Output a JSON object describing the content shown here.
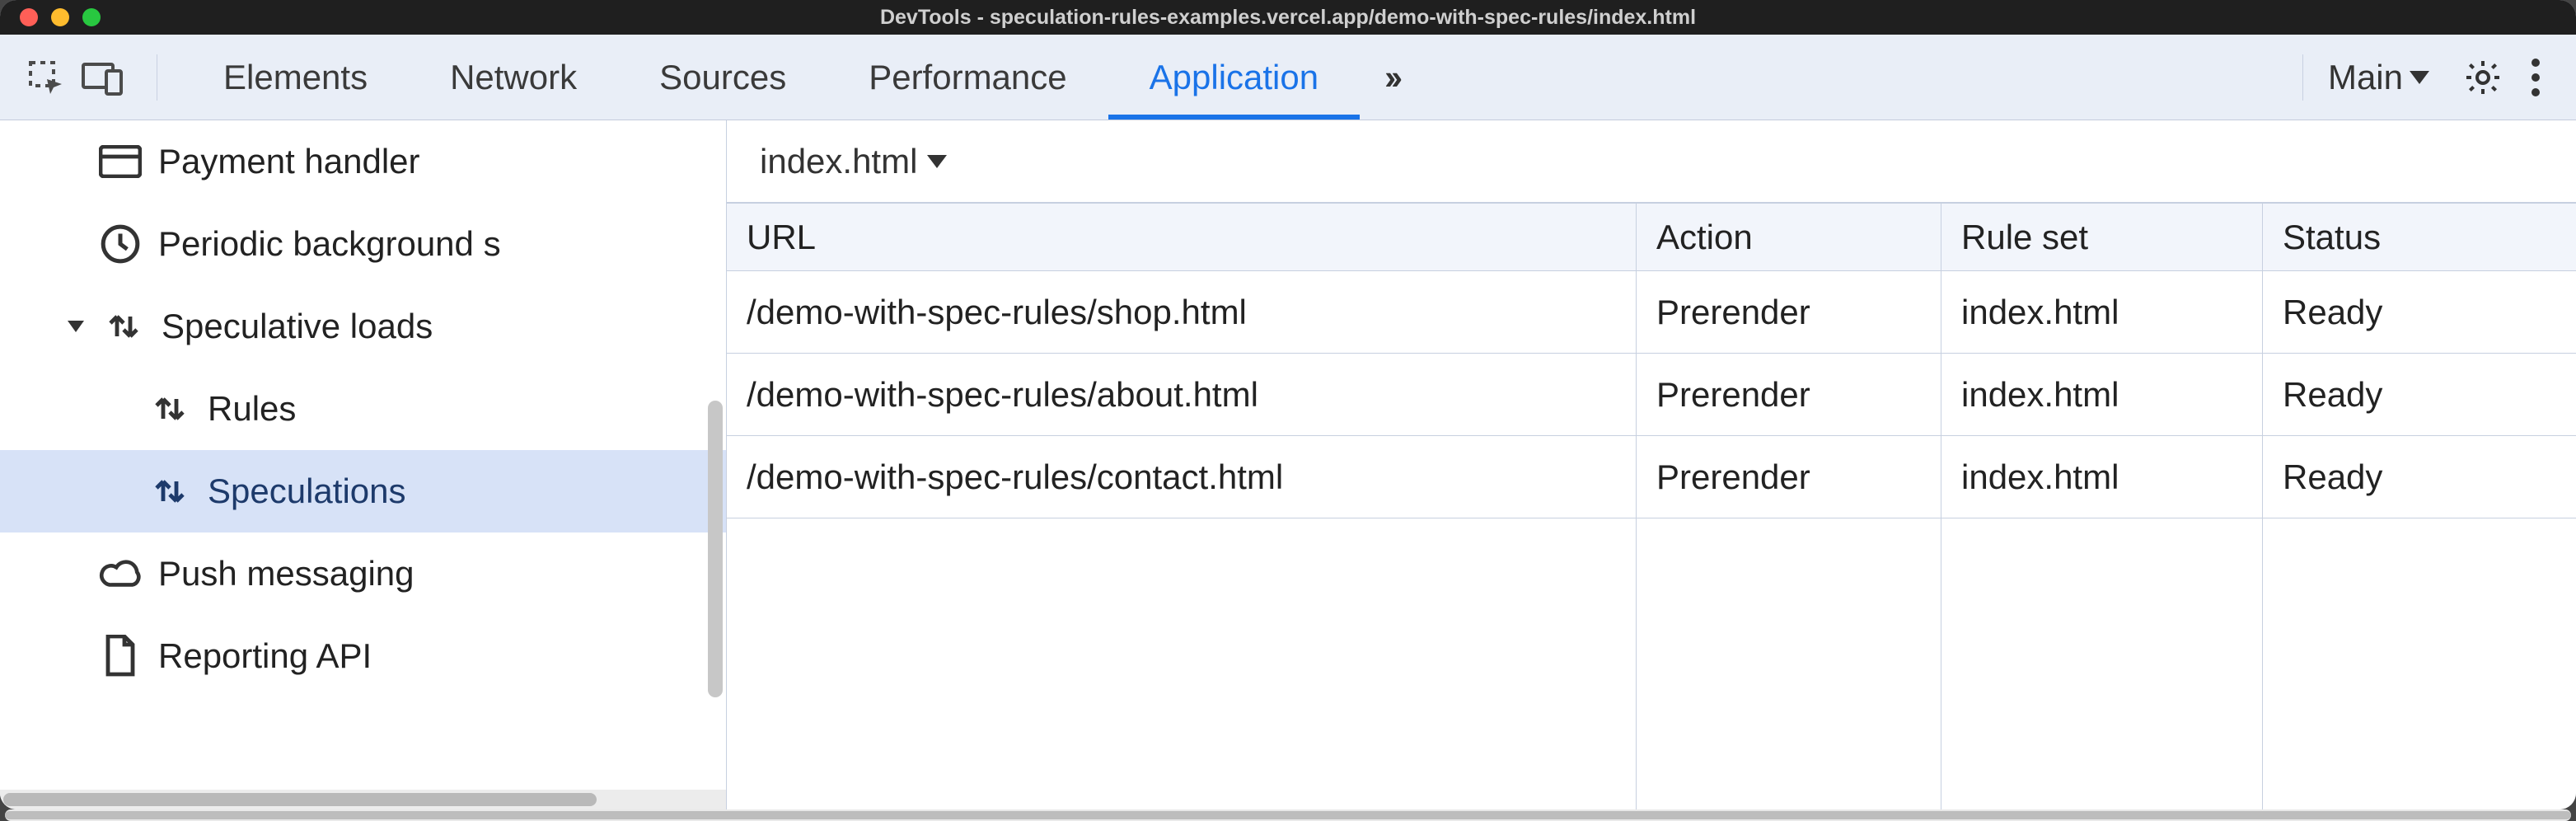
{
  "window": {
    "title": "DevTools - speculation-rules-examples.vercel.app/demo-with-spec-rules/index.html"
  },
  "toolbar": {
    "tabs": [
      "Elements",
      "Network",
      "Sources",
      "Performance",
      "Application"
    ],
    "active_tab_index": 4,
    "target_label": "Main"
  },
  "sidebar": {
    "items": [
      {
        "label": "Payment handler",
        "icon": "credit-card-icon",
        "depth": 1
      },
      {
        "label": "Periodic background s",
        "icon": "clock-icon",
        "depth": 1
      },
      {
        "label": "Speculative loads",
        "icon": "swap-arrows-icon",
        "depth": 1,
        "expanded": true
      },
      {
        "label": "Rules",
        "icon": "swap-arrows-icon",
        "depth": 2
      },
      {
        "label": "Speculations",
        "icon": "swap-arrows-icon",
        "depth": 2,
        "selected": true
      },
      {
        "label": "Push messaging",
        "icon": "cloud-icon",
        "depth": 1
      },
      {
        "label": "Reporting API",
        "icon": "document-icon",
        "depth": 1
      }
    ]
  },
  "main": {
    "breadcrumb": "index.html",
    "columns": [
      "URL",
      "Action",
      "Rule set",
      "Status"
    ],
    "rows": [
      {
        "url": "/demo-with-spec-rules/shop.html",
        "action": "Prerender",
        "ruleset": "index.html",
        "status": "Ready"
      },
      {
        "url": "/demo-with-spec-rules/about.html",
        "action": "Prerender",
        "ruleset": "index.html",
        "status": "Ready"
      },
      {
        "url": "/demo-with-spec-rules/contact.html",
        "action": "Prerender",
        "ruleset": "index.html",
        "status": "Ready"
      }
    ]
  }
}
